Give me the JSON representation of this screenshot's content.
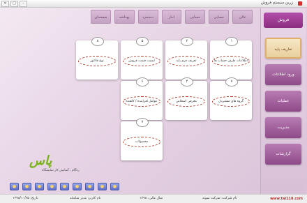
{
  "window": {
    "title": "زرین سیستم فروش"
  },
  "top_menu": [
    "صفحه‌ای",
    "بهداشه",
    "دستمزد",
    "انبار",
    "حسابی",
    "حسابی",
    "عالی"
  ],
  "sidebar": {
    "header": "فروش",
    "items": [
      {
        "label": "تعاریف پایه",
        "active": true
      },
      {
        "label": "ورود اطلاعات",
        "active": false
      },
      {
        "label": "عملیات",
        "active": false
      },
      {
        "label": "مدیریت",
        "active": false
      },
      {
        "label": "گزارشات",
        "active": false
      }
    ]
  },
  "cards": [
    {
      "num": "۱",
      "label": "اطلاعات طرف حساب ها"
    },
    {
      "num": "۲",
      "label": "تعریف فرم پایه"
    },
    {
      "num": "۵",
      "label": "لیست قیمت فروش"
    },
    {
      "num": "۸",
      "label": "نوع فاکتور"
    },
    {
      "num": "۷",
      "label": "گروه های مشتریان"
    },
    {
      "num": "۴",
      "label": "معرفی اشخاص"
    },
    {
      "num": "۶",
      "label": "عوامل افزاینده / کاهنده"
    },
    {
      "num": "۷",
      "label": "محصولات"
    }
  ],
  "logo": {
    "mark": "پاس",
    "tagline": "ره‌گام ، آسایش کار نمایشگاه"
  },
  "toolbar_icons": [
    "lock-icon",
    "key-icon",
    "globe-icon",
    "mail-icon",
    "folder-icon",
    "home-icon",
    "note-icon",
    "print-icon",
    "search-icon"
  ],
  "status": {
    "left": "تاریخ: ۱۳۹۸/۱۰/۲۵",
    "mid1": "نام کاربر: مدیر سامانه",
    "mid2": "سال مالی: ۱۳۹۸",
    "right": "نام شرکت: شرکت نمونه",
    "watermark": "www.tai118.com"
  }
}
